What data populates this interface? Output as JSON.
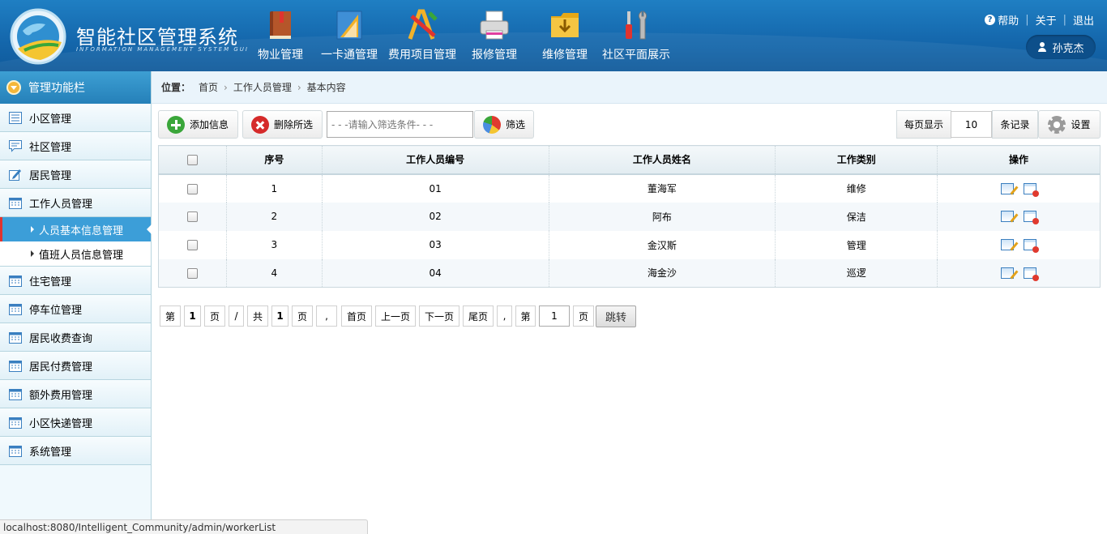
{
  "header": {
    "title": "智能社区管理系统",
    "subtitle": "INFORMATION MANAGEMENT SYSTEM GUI",
    "nav": [
      {
        "label": "物业管理",
        "icon": "book-icon"
      },
      {
        "label": "一卡通管理",
        "icon": "ruler-icon"
      },
      {
        "label": "费用项目管理",
        "icon": "pencil-ruler-icon"
      },
      {
        "label": "报修管理",
        "icon": "printer-icon"
      },
      {
        "label": "维修管理",
        "icon": "folder-download-icon"
      },
      {
        "label": "社区平面展示",
        "icon": "tools-icon"
      }
    ],
    "links": {
      "help": "帮助",
      "about": "关于",
      "logout": "退出"
    },
    "user": "孙克杰"
  },
  "sidebar": {
    "title": "管理功能栏",
    "items": [
      {
        "label": "小区管理"
      },
      {
        "label": "社区管理"
      },
      {
        "label": "居民管理"
      },
      {
        "label": "工作人员管理"
      }
    ],
    "subitems": [
      {
        "label": "人员基本信息管理",
        "active": true
      },
      {
        "label": "值班人员信息管理",
        "active": false
      }
    ],
    "items_after": [
      {
        "label": "住宅管理"
      },
      {
        "label": "停车位管理"
      },
      {
        "label": "居民收费查询"
      },
      {
        "label": "居民付费管理"
      },
      {
        "label": "额外费用管理"
      },
      {
        "label": "小区快递管理"
      },
      {
        "label": "系统管理"
      }
    ]
  },
  "breadcrumb": {
    "label": "位置：",
    "items": [
      "首页",
      "工作人员管理",
      "基本内容"
    ]
  },
  "toolbar": {
    "add": "添加信息",
    "delete": "删除所选",
    "filter_placeholder": "- - -请输入筛选条件- - -",
    "filter": "筛选",
    "per_page_label": "每页显示",
    "per_page_value": "10",
    "records_label": "条记录",
    "settings": "设置"
  },
  "table": {
    "headers": [
      "序号",
      "工作人员编号",
      "工作人员姓名",
      "工作类别",
      "操作"
    ],
    "rows": [
      {
        "no": "1",
        "code": "01",
        "name": "董海军",
        "type": "维修"
      },
      {
        "no": "2",
        "code": "02",
        "name": "阿布",
        "type": "保洁"
      },
      {
        "no": "3",
        "code": "03",
        "name": "金汉斯",
        "type": "管理"
      },
      {
        "no": "4",
        "code": "04",
        "name": "海金沙",
        "type": "巡逻"
      }
    ]
  },
  "pagination": {
    "di": "第",
    "current": "1",
    "ye": "页",
    "slash": "/",
    "gong": "共",
    "total": "1",
    "ye2": "页",
    "comma": ",",
    "first": "首页",
    "prev": "上一页",
    "next": "下一页",
    "last": "尾页",
    "comma2": ",",
    "di2": "第",
    "jump_value": "1",
    "ye3": "页",
    "jump": "跳转"
  },
  "statusbar": "localhost:8080/Intelligent_Community/admin/workerList"
}
